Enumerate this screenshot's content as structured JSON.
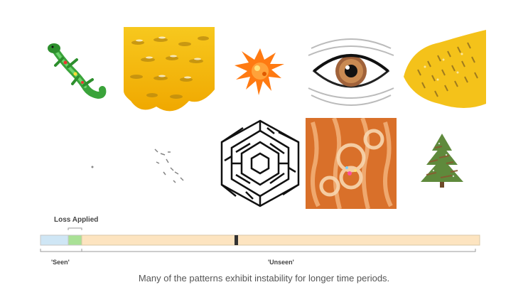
{
  "figure": {
    "caption": "Many of the patterns exhibit instability for longer time periods."
  },
  "timeline": {
    "loss_label": "Loss Applied",
    "seen_label": "'Seen'",
    "unseen_label": "'Unseen'",
    "colors": {
      "seen": "#cfe6f5",
      "loss": "#a9e196",
      "unseen": "#fde4c0",
      "marker": "#333333"
    }
  },
  "patterns": [
    {
      "name": "lizard-pattern"
    },
    {
      "name": "honey-texture-pattern"
    },
    {
      "name": "orange-splat-pattern"
    },
    {
      "name": "eye-pattern"
    },
    {
      "name": "yellow-texture-pattern"
    },
    {
      "name": "faded-dot-pattern"
    },
    {
      "name": "faded-dashes-pattern"
    },
    {
      "name": "maze-pattern"
    },
    {
      "name": "bread-texture-pattern"
    },
    {
      "name": "tree-pattern"
    }
  ]
}
